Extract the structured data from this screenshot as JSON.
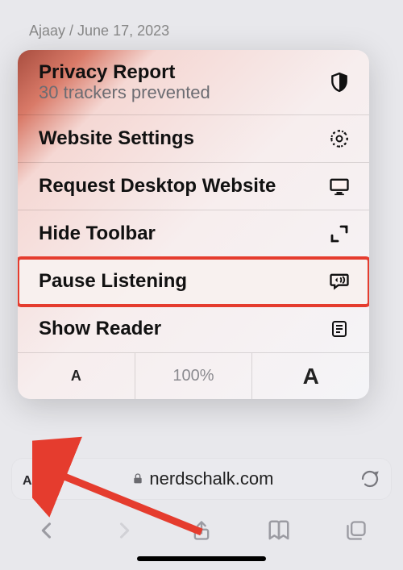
{
  "byline": "Ajaay / June 17, 2023",
  "popup": {
    "privacy": {
      "label": "Privacy Report",
      "sublabel": "30 trackers prevented"
    },
    "websiteSettings": {
      "label": "Website Settings"
    },
    "requestDesktop": {
      "label": "Request Desktop Website"
    },
    "hideToolbar": {
      "label": "Hide Toolbar"
    },
    "pauseListening": {
      "label": "Pause Listening"
    },
    "showReader": {
      "label": "Show Reader"
    },
    "zoom": {
      "smaller": "A",
      "percent": "100%",
      "bigger": "A"
    }
  },
  "address": {
    "domain": "nerdschalk.com"
  }
}
